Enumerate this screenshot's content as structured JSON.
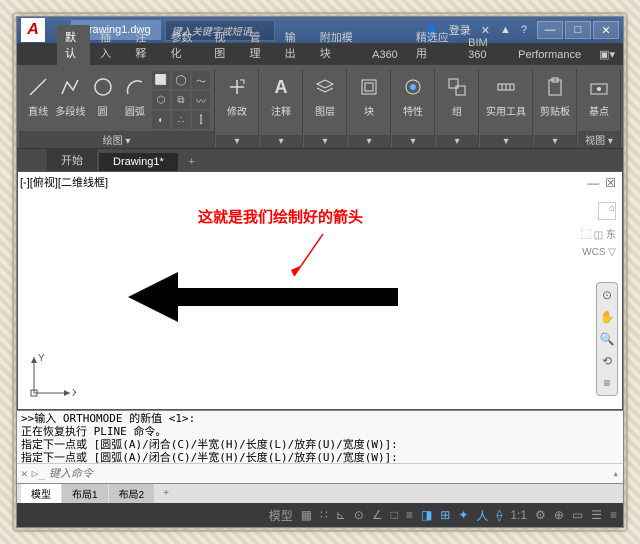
{
  "titlebar": {
    "app_initial": "A",
    "filename": "Drawing1.dwg",
    "search_placeholder": "键入关键字或短语",
    "login": "登录"
  },
  "ribbon_tabs": [
    "默认",
    "插入",
    "注释",
    "参数化",
    "视图",
    "管理",
    "输出",
    "附加模块",
    "A360",
    "精选应用",
    "BIM 360",
    "Performance"
  ],
  "panels": {
    "draw": {
      "line": "直线",
      "pline": "多段线",
      "circle": "圆",
      "arc": "圆弧",
      "label": "绘图 ▾"
    },
    "modify": {
      "btn": "修改",
      "label": "▾"
    },
    "annot": {
      "btn": "注释",
      "label": "▾"
    },
    "layer": {
      "btn": "图层",
      "label": "▾"
    },
    "block": {
      "btn": "块",
      "label": "▾"
    },
    "prop": {
      "btn": "特性",
      "label": "▾"
    },
    "group": {
      "btn": "组",
      "label": "▾"
    },
    "util": {
      "btn": "实用工具",
      "label": "▾"
    },
    "clip": {
      "btn": "剪贴板",
      "label": "▾"
    },
    "base": {
      "btn": "基点",
      "label": "视图 ▾"
    }
  },
  "file_tabs": {
    "start": "开始",
    "active": "Drawing1*",
    "add": "+"
  },
  "viewport": {
    "label": "[-][俯视][二维线框]",
    "annotation": "这就是我们绘制好的箭头",
    "wcs": "WCS ▽",
    "axis_x": "X",
    "axis_y": "Y"
  },
  "cmd": {
    "l1": ">>输入 ORTHOMODE 的新值 <1>:",
    "l2": "正在恢复执行 PLINE 命令。",
    "l3": "指定下一点或 [圆弧(A)/闭合(C)/半宽(H)/长度(L)/放弃(U)/宽度(W)]:",
    "l4": "指定下一点或 [圆弧(A)/闭合(C)/半宽(H)/长度(L)/放弃(U)/宽度(W)]:",
    "placeholder": "键入命令"
  },
  "layout_tabs": {
    "model": "模型",
    "l1": "布局1",
    "l2": "布局2",
    "add": "+"
  },
  "status": {
    "model": "模型",
    "scale": "1:1"
  }
}
